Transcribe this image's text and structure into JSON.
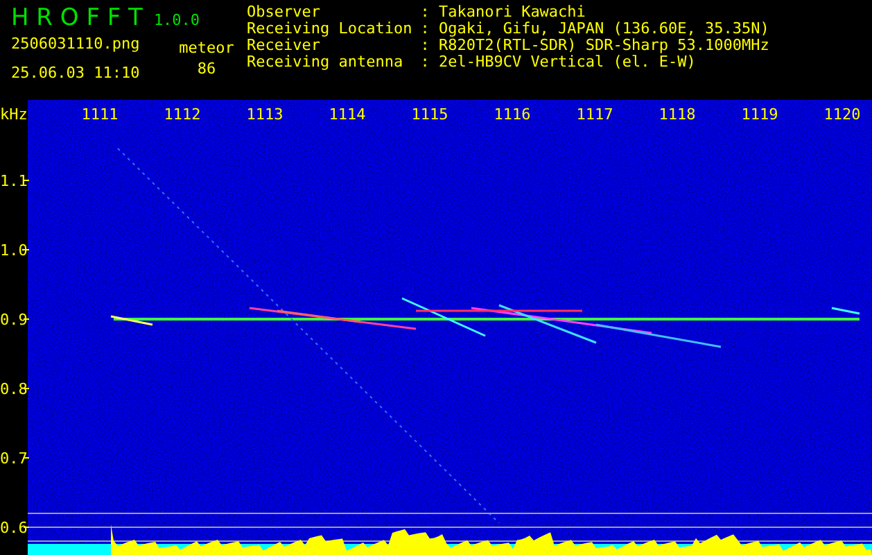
{
  "app": {
    "title": "H R O F F T",
    "version": "1.0.0"
  },
  "file": {
    "name": "2506031110.png",
    "timestamp": "25.06.03 11:10"
  },
  "detection": {
    "label": "meteor",
    "count": "86"
  },
  "station": [
    {
      "label": "Observer",
      "value": ": Takanori Kawachi"
    },
    {
      "label": "Receiving Location",
      "value": ": Ogaki, Gifu, JAPAN (136.60E, 35.35N)"
    },
    {
      "label": "Receiver",
      "value": ": R820T2(RTL-SDR) SDR-Sharp 53.1000MHz"
    },
    {
      "label": "Receiving antenna",
      "value": ": 2el-HB9CV Vertical (el. E-W)"
    }
  ],
  "spectrogram": {
    "y_unit": "kHz",
    "y_ticks": [
      "1.1",
      "1.0",
      "0.9",
      "0.8",
      "0.7",
      "0.6"
    ],
    "x_ticks": [
      "1111",
      "1112",
      "1113",
      "1114",
      "1115",
      "1116",
      "1117",
      "1118",
      "1119",
      "1120"
    ]
  }
}
